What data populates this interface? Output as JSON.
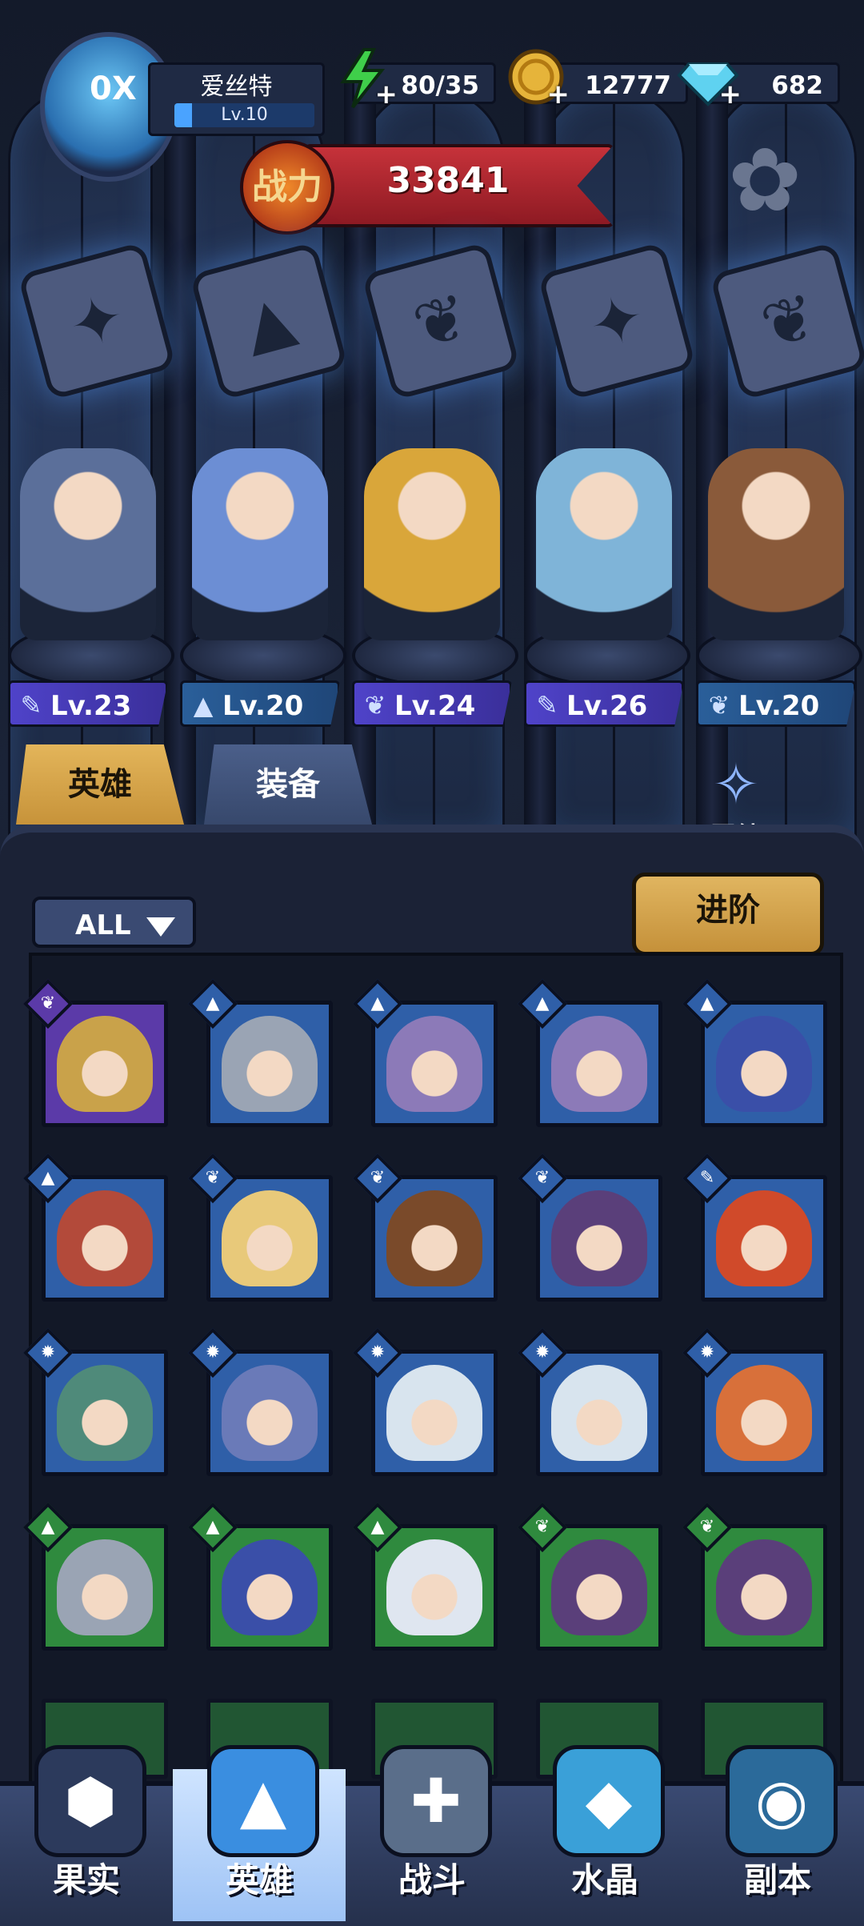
{
  "player": {
    "name": "爱丝特",
    "level": "Lv.10",
    "avatar_text": "0X"
  },
  "resources": {
    "energy": "80/35",
    "gold": "12777",
    "gems": "682"
  },
  "power": {
    "label": "战力",
    "value": "33841"
  },
  "lineup": [
    {
      "level": "Lv.23",
      "class": "wrench",
      "style": "purple",
      "color": "#5b6f9a"
    },
    {
      "level": "Lv.20",
      "class": "hat",
      "style": "blue",
      "color": "#6c8ed4"
    },
    {
      "level": "Lv.24",
      "class": "wing",
      "style": "purple",
      "color": "#d9a63a"
    },
    {
      "level": "Lv.26",
      "class": "wrench",
      "style": "purple",
      "color": "#7fb4d8"
    },
    {
      "level": "Lv.20",
      "class": "wing",
      "style": "blue",
      "color": "#8a5a3a"
    }
  ],
  "tabs": {
    "heroes": "英雄",
    "equipment": "装备"
  },
  "bond_label": "羁绊",
  "filter_label": "ALL",
  "advance_label": "进阶",
  "roster": [
    {
      "rarity": "purple",
      "class": "wing",
      "color": "#c9a24a"
    },
    {
      "rarity": "blue",
      "class": "hat",
      "color": "#9aa4b4"
    },
    {
      "rarity": "blue",
      "class": "hat",
      "color": "#8c7ab8"
    },
    {
      "rarity": "blue",
      "class": "hat",
      "color": "#8c7ab8"
    },
    {
      "rarity": "blue",
      "class": "hat",
      "color": "#3a4fa8"
    },
    {
      "rarity": "blue",
      "class": "hat",
      "color": "#b34a3a"
    },
    {
      "rarity": "blue",
      "class": "wing",
      "color": "#e8c97a"
    },
    {
      "rarity": "blue",
      "class": "wing",
      "color": "#7a4a2a"
    },
    {
      "rarity": "blue",
      "class": "wing",
      "color": "#5a3f7a"
    },
    {
      "rarity": "blue",
      "class": "wrench",
      "color": "#d04a2a"
    },
    {
      "rarity": "blue",
      "class": "beast",
      "color": "#4f8a7a"
    },
    {
      "rarity": "blue",
      "class": "beast",
      "color": "#6a7ab8"
    },
    {
      "rarity": "blue",
      "class": "beast",
      "color": "#d8e4ee"
    },
    {
      "rarity": "blue",
      "class": "beast",
      "color": "#d8e4ee"
    },
    {
      "rarity": "blue",
      "class": "beast",
      "color": "#d8703a"
    },
    {
      "rarity": "green",
      "class": "hat",
      "color": "#9aa4b4"
    },
    {
      "rarity": "green",
      "class": "hat",
      "color": "#3a4fa8"
    },
    {
      "rarity": "green",
      "class": "hat",
      "color": "#dfe6f0"
    },
    {
      "rarity": "green",
      "class": "wing",
      "color": "#5a3f7a"
    },
    {
      "rarity": "green",
      "class": "wing",
      "color": "#5a3f7a"
    }
  ],
  "nav": [
    {
      "label": "果实",
      "icon": "fruit-icon",
      "active": false
    },
    {
      "label": "英雄",
      "icon": "hero-hat-icon",
      "active": true
    },
    {
      "label": "战斗",
      "icon": "battle-sword-icon",
      "active": false
    },
    {
      "label": "水晶",
      "icon": "crystal-icon",
      "active": false
    },
    {
      "label": "副本",
      "icon": "dungeon-portal-icon",
      "active": false
    }
  ]
}
